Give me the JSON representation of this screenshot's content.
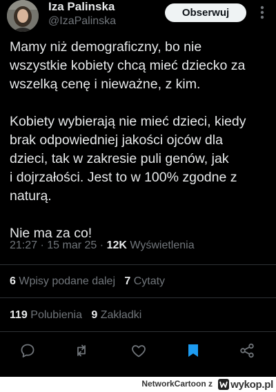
{
  "author": {
    "name": "Iza Palinska",
    "handle": "@IzaPalinska"
  },
  "follow_button": "Obserwuj",
  "tweet": {
    "lines": [
      "Mamy niż demograficzny, bo nie",
      "wszystkie kobiety chcą mieć dziecko za",
      "wszelką cenę i nieważne, z kim.",
      "",
      "Kobiety wybierają nie mieć dzieci, kiedy",
      "brak odpowiedniej jakości ojców dla",
      "dzieci, tak w zakresie puli genów, jak",
      "i dojrzałości. Jest to w 100% zgodne z",
      "naturą.",
      "",
      "Nie ma za co!"
    ]
  },
  "meta": {
    "time": "21:27",
    "separator": "·",
    "date": "15 mar 25",
    "views_count": "12K",
    "views_label": "Wyświetlenia"
  },
  "stats": {
    "reposts_count": "6",
    "reposts_label": "Wpisy podane dalej",
    "quotes_count": "7",
    "quotes_label": "Cytaty",
    "likes_count": "119",
    "likes_label": "Polubienia",
    "bookmarks_count": "9",
    "bookmarks_label": "Zakładki"
  },
  "icons": {
    "more": "more-vertical-icon",
    "reply": "reply-icon",
    "repost": "repost-icon",
    "like": "heart-icon",
    "bookmark": "bookmark-icon",
    "share": "share-icon"
  },
  "colors": {
    "background": "#000000",
    "text": "#e7e9ea",
    "muted": "#71767b",
    "accent": "#1d9bf0"
  },
  "footer": {
    "user": "NetworkCartoon",
    "suffix": "z",
    "site": "wykop.pl"
  }
}
